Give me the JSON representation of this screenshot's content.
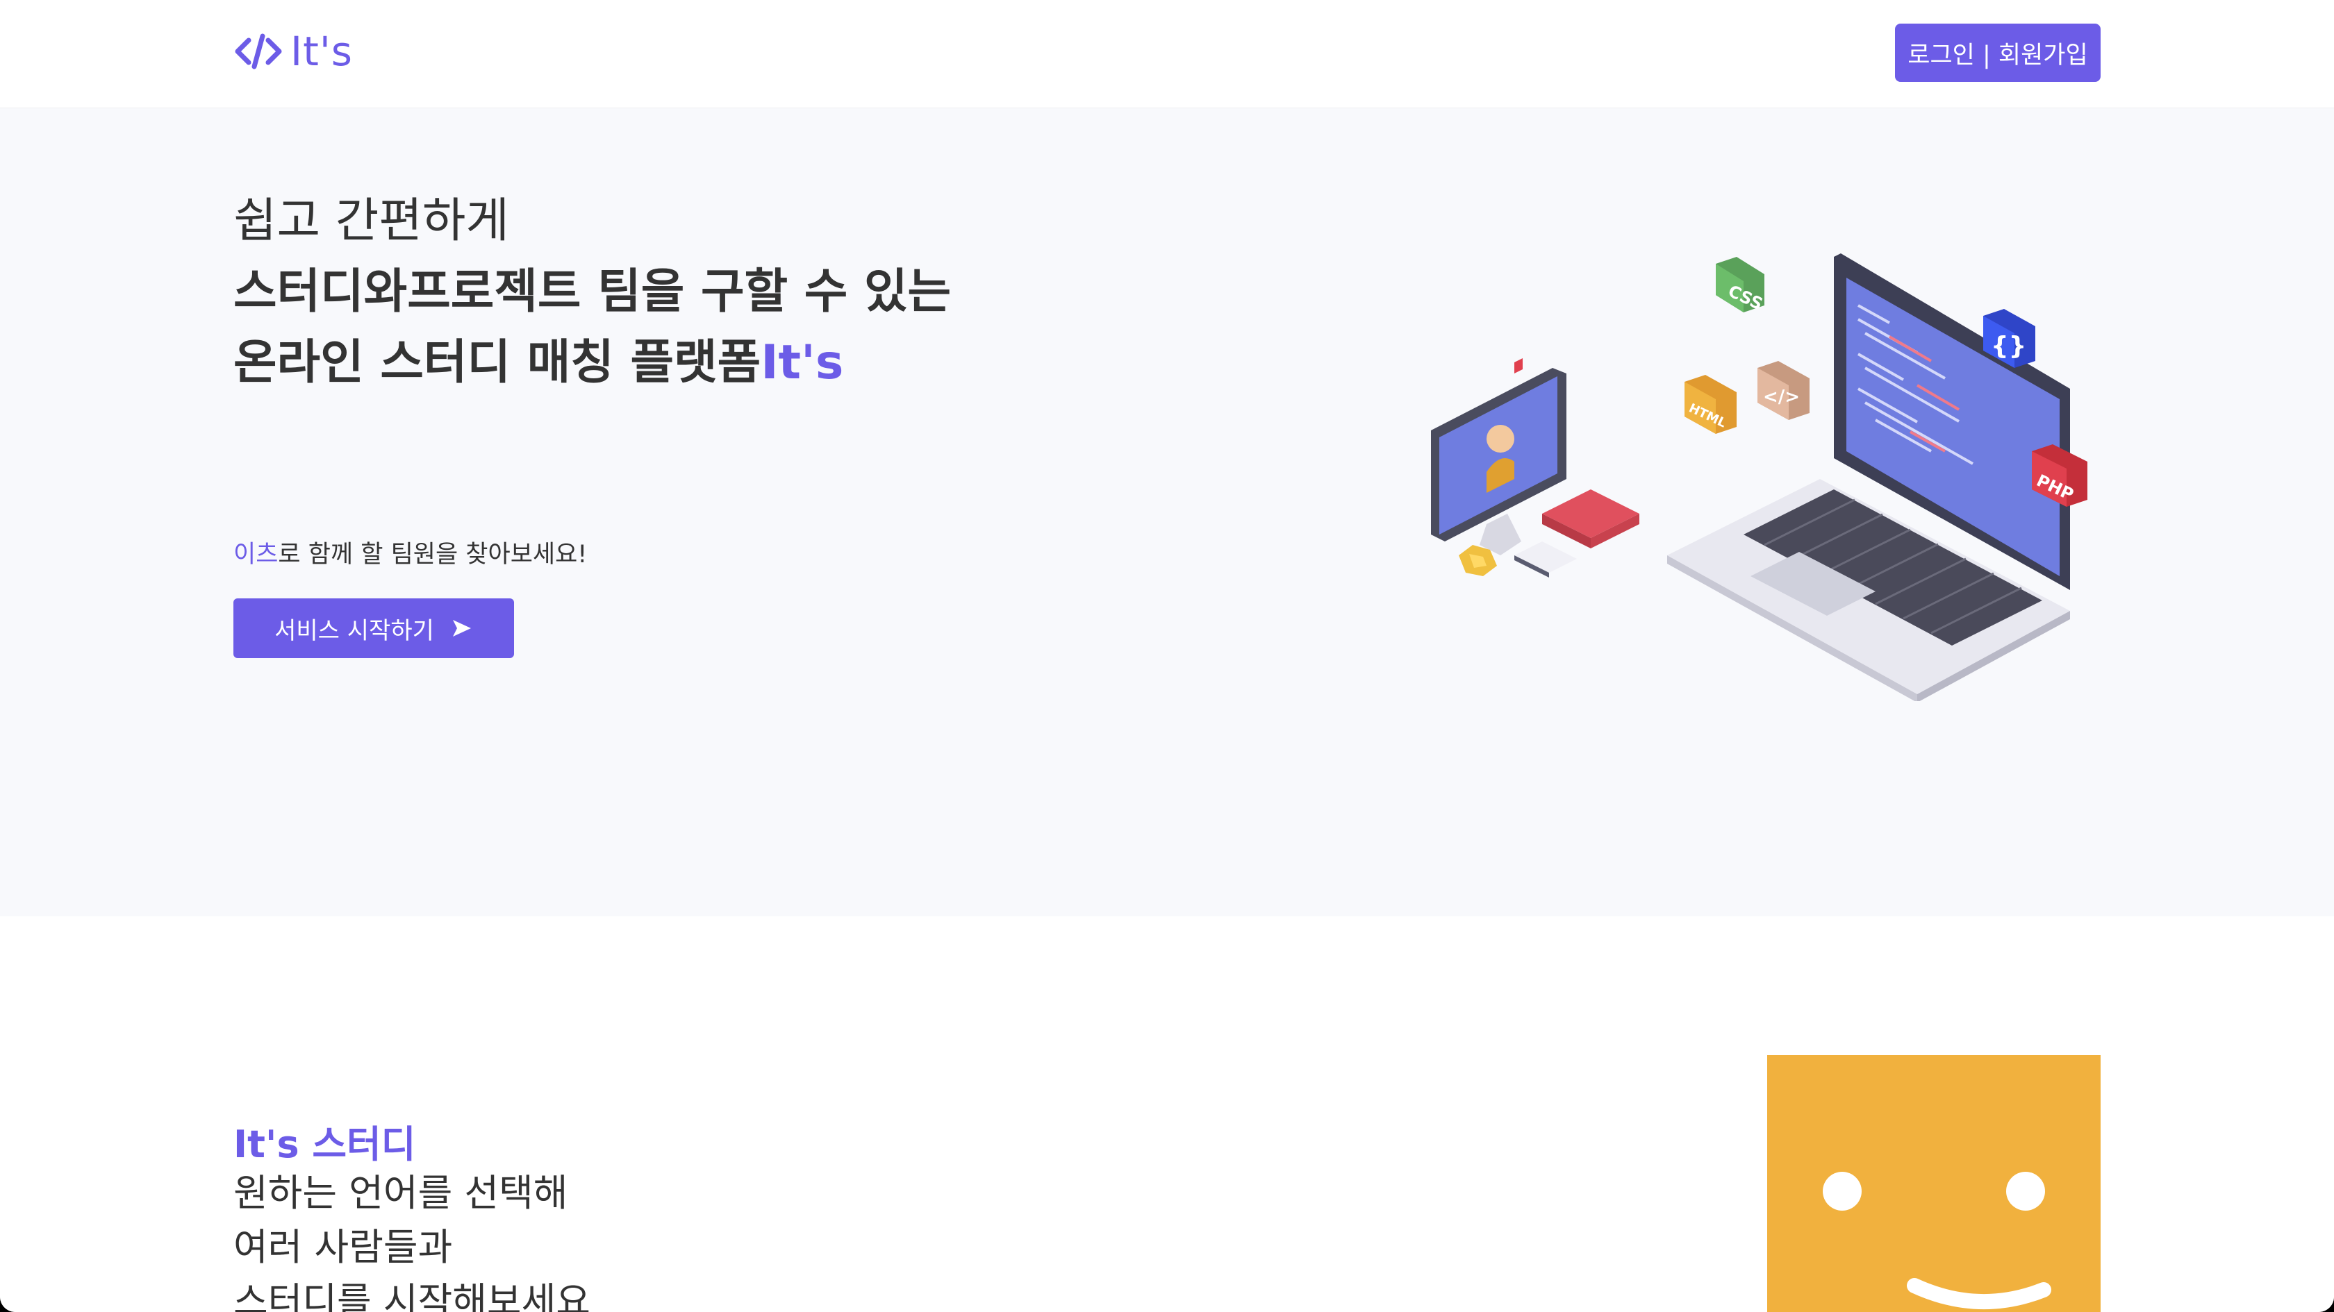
{
  "header": {
    "logo_text": "It's",
    "logo_icon": "code-brackets-icon",
    "auth_button": "로그인 | 회원가입"
  },
  "hero": {
    "title_line1": "쉽고 간편하게",
    "title_line2": "스터디와프로젝트 팀을 구할 수 있는",
    "title_line3": "온라인 스터디 매칭 플랫폼",
    "title_brand": "It's",
    "subtitle_highlight": "이츠",
    "subtitle_rest": "로 함께 할 팀원을 찾아보세요!",
    "cta_label": "서비스 시작하기",
    "cta_icon": "send-icon",
    "illustration_labels": {
      "css": "CSS",
      "html": "HTML",
      "php": "PHP",
      "braces": "{}",
      "code": "</>"
    }
  },
  "study_section": {
    "title": "It's 스터디",
    "lines": [
      "원하는 언어를 선택해",
      "여러 사람들과",
      "스터디를 시작해보세요"
    ]
  },
  "colors": {
    "accent": "#6c5ce7",
    "hero_bg": "#f8f9fc",
    "smiley": "#f1b13e"
  }
}
